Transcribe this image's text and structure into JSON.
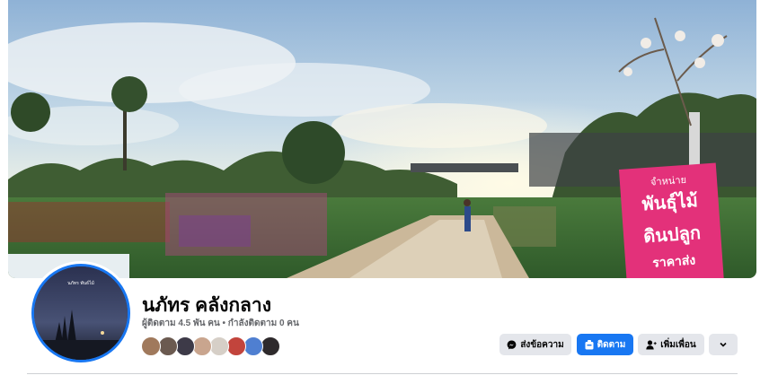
{
  "page": {
    "name": "นภัทร คลังกลาง",
    "stats": "ผู้ติดตาม 4.5 พัน คน • กำลังติดตาม 0 คน"
  },
  "cover": {
    "sign_lines": [
      "จำหน่าย",
      "พันธุ์ไม้",
      "ดินปลูก",
      "ราคาส่ง"
    ]
  },
  "avatar": {
    "caption": "นภัทร พันธ์ไม้"
  },
  "actions": {
    "message_label": "ส่งข้อความ",
    "follow_label": "ติดตาม",
    "add_friend_label": "เพิ่มเพื่อน"
  },
  "follower_avatars": [
    {
      "color": "#a0795c"
    },
    {
      "color": "#6b5a50"
    },
    {
      "color": "#3d3a48"
    },
    {
      "color": "#c9a58e"
    },
    {
      "color": "#d6cfc7"
    },
    {
      "color": "#c2443c"
    },
    {
      "color": "#4f7fd1"
    },
    {
      "color": "#2e2a2c"
    }
  ],
  "colors": {
    "accent": "#1877f2",
    "button_grey": "#e4e6eb",
    "text_secondary": "#65676b"
  }
}
